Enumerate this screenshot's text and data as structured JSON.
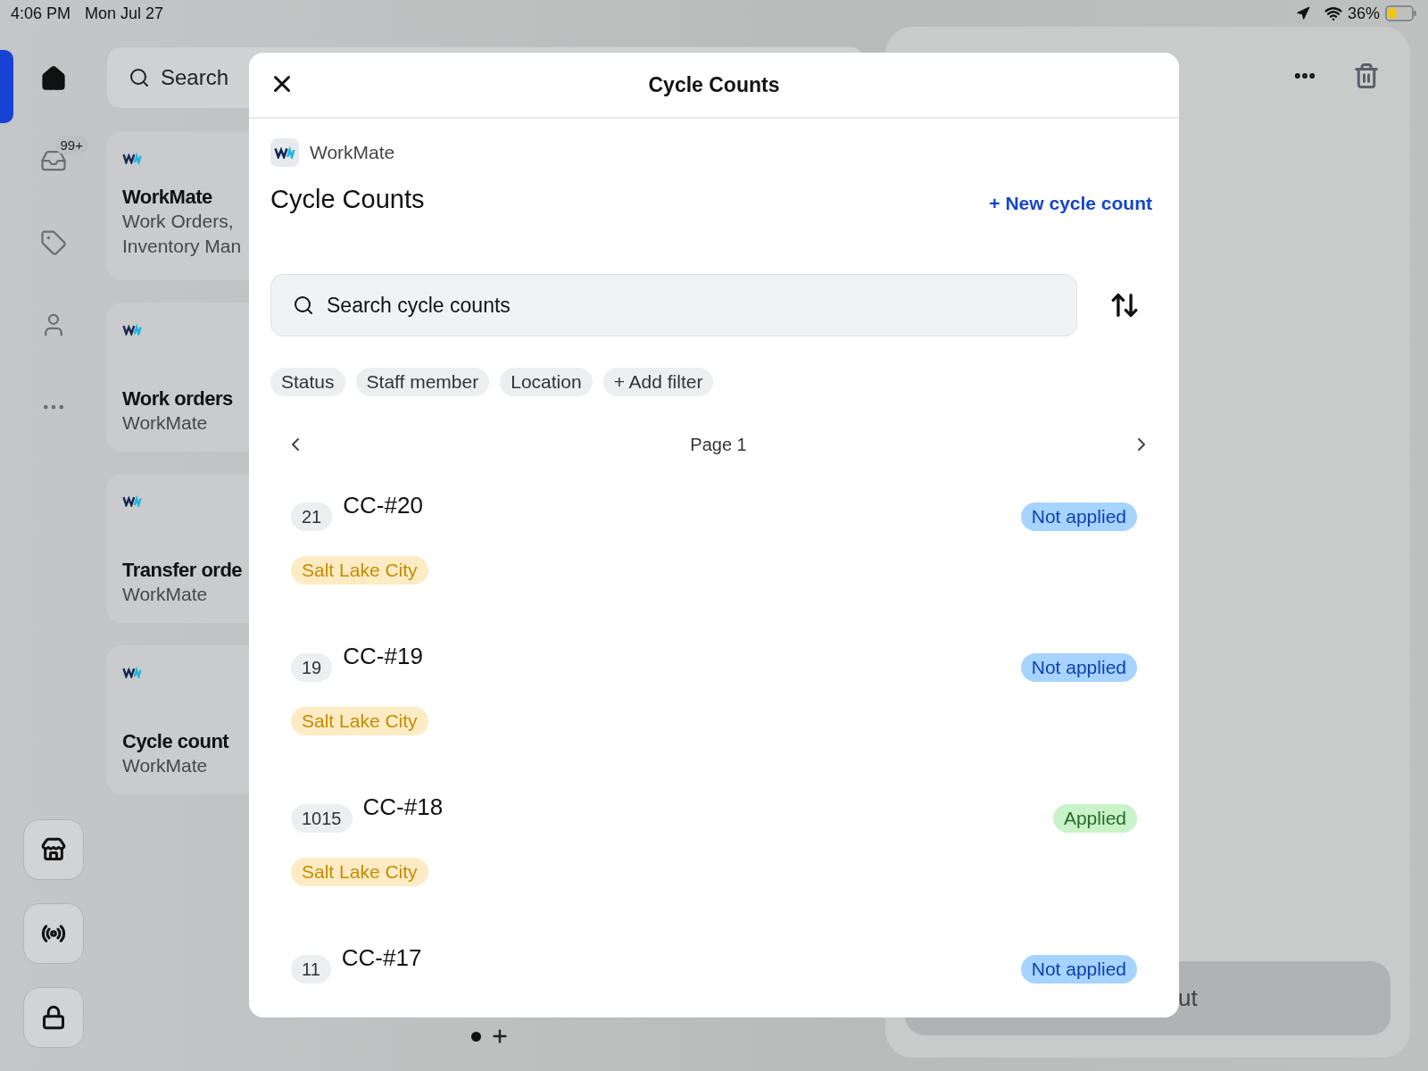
{
  "status_bar": {
    "time": "4:06 PM",
    "date": "Mon Jul 27",
    "battery": "36%"
  },
  "rail": {
    "items": [
      {
        "kind": "home",
        "selected": true
      },
      {
        "kind": "inbox",
        "selected": false,
        "badge": "99+"
      },
      {
        "kind": "tag",
        "selected": false
      },
      {
        "kind": "person",
        "selected": false
      },
      {
        "kind": "more",
        "selected": false
      }
    ],
    "tools": [
      {
        "kind": "store"
      },
      {
        "kind": "broadcast"
      },
      {
        "kind": "lock"
      }
    ]
  },
  "search": {
    "placeholder": "Search"
  },
  "cards": [
    {
      "title": "WorkMate",
      "lines": [
        "Work Orders,",
        "Inventory Man"
      ]
    },
    {
      "title": "Work orders",
      "lines": [
        "WorkMate"
      ]
    },
    {
      "title": "Transfer orde",
      "lines": [
        "WorkMate"
      ]
    },
    {
      "title": "Cycle count",
      "lines": [
        "WorkMate"
      ]
    }
  ],
  "right_panel": {
    "field_text": "ut"
  },
  "modal": {
    "title": "Cycle Counts",
    "app_name": "WorkMate",
    "heading": "Cycle Counts",
    "new_link": "+ New cycle count",
    "search": {
      "placeholder": "Search cycle counts"
    },
    "filters": [
      "Status",
      "Staff member",
      "Location",
      "+ Add filter"
    ],
    "page": "Page 1",
    "rows": [
      {
        "count": "21",
        "name": "CC-#20",
        "status": {
          "label": "Not applied",
          "kind": "pending"
        },
        "location": "Salt Lake City"
      },
      {
        "count": "19",
        "name": "CC-#19",
        "status": {
          "label": "Not applied",
          "kind": "pending"
        },
        "location": "Salt Lake City"
      },
      {
        "count": "1015",
        "name": "CC-#18",
        "status": {
          "label": "Applied",
          "kind": "applied"
        },
        "location": "Salt Lake City"
      },
      {
        "count": "11",
        "name": "CC-#17",
        "status": {
          "label": "Not applied",
          "kind": "pending"
        }
      }
    ]
  }
}
